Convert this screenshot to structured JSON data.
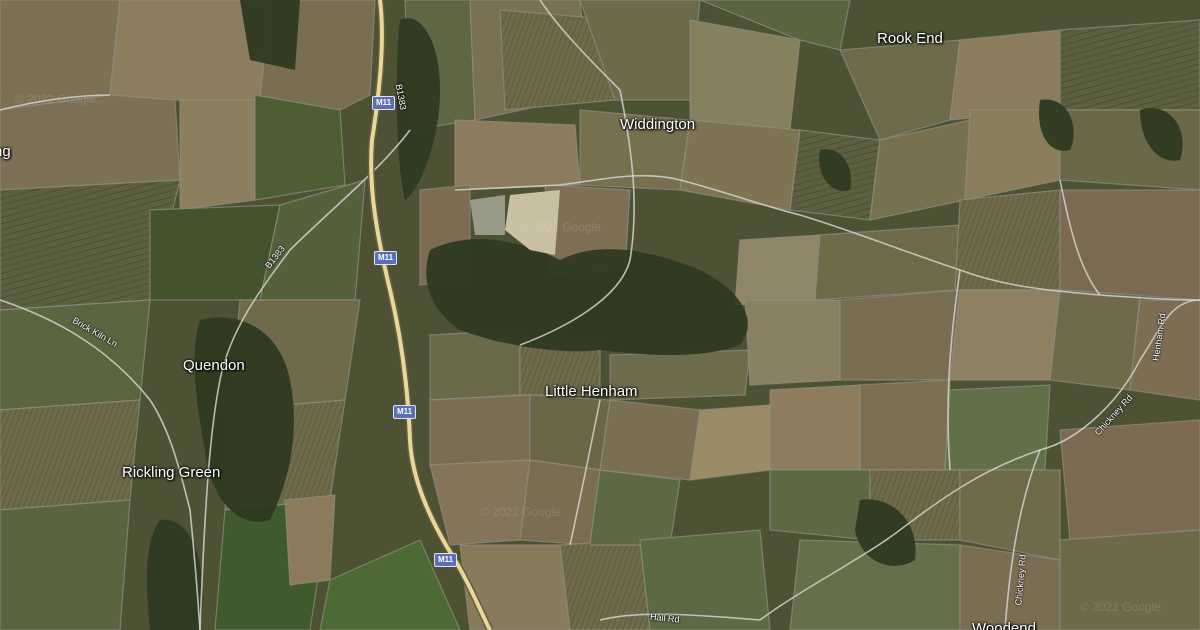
{
  "map": {
    "type": "satellite",
    "colors": {
      "field_dark": "#4a4e32",
      "field_mid": "#6b6747",
      "field_light": "#8a7c5c",
      "woodland": "#2f3a22",
      "motorway": "#e6d79a",
      "road": "#cfcfcf"
    },
    "places": [
      {
        "id": "rook-end",
        "name": "Rook End"
      },
      {
        "id": "widdington",
        "name": "Widdington"
      },
      {
        "id": "quendon",
        "name": "Quendon"
      },
      {
        "id": "little-henham",
        "name": "Little Henham"
      },
      {
        "id": "rickling-green",
        "name": "Rickling Green"
      },
      {
        "id": "woodend",
        "name": "Woodend"
      },
      {
        "id": "left-edge",
        "name": "ng"
      }
    ],
    "roads": [
      {
        "id": "b1383-north",
        "name": "B1383"
      },
      {
        "id": "b1383-west",
        "name": "B1383"
      },
      {
        "id": "brick-kiln-ln",
        "name": "Brick Kiln Ln"
      },
      {
        "id": "hall-rd",
        "name": "Hall Rd"
      },
      {
        "id": "henham-rd",
        "name": "Henham Rd"
      },
      {
        "id": "chickney-rd-east",
        "name": "Chickney Rd"
      },
      {
        "id": "chickney-rd-south",
        "name": "Chickney Rd"
      }
    ],
    "shields": [
      "M11",
      "M11",
      "M11",
      "M11"
    ],
    "watermarks": [
      "© 2022 Google",
      "© 2022 Google",
      "© 2022 Google",
      "© 2022 Google"
    ]
  }
}
